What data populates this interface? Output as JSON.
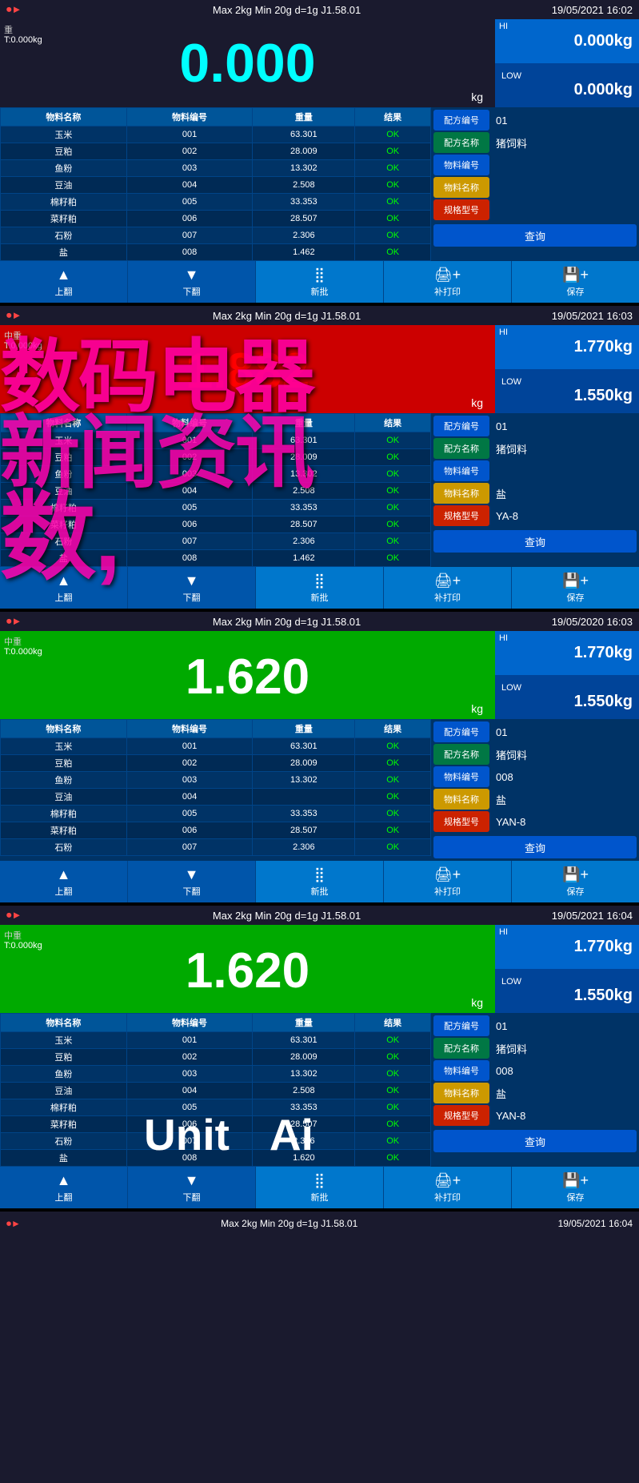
{
  "panels": [
    {
      "id": "panel1",
      "topBar": {
        "left": "⏺►",
        "center": "Max 2kg  Min 20g  d=1g    J1.58.01",
        "right": "19/05/2021  16:02"
      },
      "weight": {
        "zero": "重",
        "tare": "T:0.000kg",
        "value": "0.000",
        "unit": "kg",
        "status": "normal"
      },
      "hi": {
        "label": "HI",
        "value": "0.000",
        "unit": "kg"
      },
      "low": {
        "label": "LOW",
        "value": "0.000",
        "unit": "kg"
      },
      "tableHeaders": [
        "物料名称",
        "物料编号",
        "重量",
        "结果"
      ],
      "tableRows": [
        [
          "玉米",
          "001",
          "63.301",
          "OK"
        ],
        [
          "豆粕",
          "002",
          "28.009",
          "OK"
        ],
        [
          "鱼粉",
          "003",
          "13.302",
          "OK"
        ],
        [
          "豆油",
          "004",
          "2.508",
          "OK"
        ],
        [
          "棉籽粕",
          "005",
          "33.353",
          "OK"
        ],
        [
          "菜籽粕",
          "006",
          "28.507",
          "OK"
        ],
        [
          "石粉",
          "007",
          "2.306",
          "OK"
        ],
        [
          "盐",
          "008",
          "1.462",
          "OK"
        ]
      ],
      "infoPanel": {
        "rows": [
          {
            "label": "配方编号",
            "labelClass": "blue",
            "value": "01"
          },
          {
            "label": "配方名称",
            "labelClass": "green",
            "value": "猪饲料"
          },
          {
            "label": "物料编号",
            "labelClass": "blue",
            "value": ""
          },
          {
            "label": "物料名称",
            "labelClass": "yellow",
            "value": ""
          },
          {
            "label": "规格型号",
            "labelClass": "red",
            "value": ""
          }
        ],
        "queryBtn": "查询"
      },
      "buttons": [
        {
          "icon": "▲",
          "label": "上翻"
        },
        {
          "icon": "▼",
          "label": "下翻"
        },
        {
          "icon": "⣿",
          "label": "新批"
        },
        {
          "icon": "🖨+",
          "label": "补打印"
        },
        {
          "icon": "💾+",
          "label": "保存"
        }
      ]
    },
    {
      "id": "panel2",
      "topBar": {
        "left": "⏺►",
        "center": "Max 2kg  Min 20g  d=1g    J1.58.01",
        "right": "19/05/2021  16:03"
      },
      "weight": {
        "zero": "中重",
        "tare": "T:0.000kg",
        "value": "1.882",
        "unit": "kg",
        "status": "over"
      },
      "hi": {
        "label": "HI",
        "value": "1.770",
        "unit": "kg"
      },
      "low": {
        "label": "LOW",
        "value": "1.550",
        "unit": "kg"
      },
      "tableHeaders": [
        "物料名称",
        "物料编号",
        "重量",
        "结果"
      ],
      "tableRows": [
        [
          "玉米",
          "001",
          "63.301",
          "OK"
        ],
        [
          "豆粕",
          "002",
          "28.009",
          "OK"
        ],
        [
          "鱼粉",
          "003",
          "13.302",
          "OK"
        ],
        [
          "豆油",
          "004",
          "2.508",
          "OK"
        ],
        [
          "棉籽粕",
          "005",
          "33.353",
          "OK"
        ],
        [
          "菜籽粕",
          "006",
          "28.507",
          "OK"
        ],
        [
          "石粉",
          "007",
          "2.306",
          "OK"
        ],
        [
          "盐",
          "008",
          "1.462",
          "OK"
        ]
      ],
      "infoPanel": {
        "rows": [
          {
            "label": "配方编号",
            "labelClass": "blue",
            "value": "01"
          },
          {
            "label": "配方名称",
            "labelClass": "green",
            "value": "猪饲料"
          },
          {
            "label": "物料编号",
            "labelClass": "blue",
            "value": ""
          },
          {
            "label": "物料名称",
            "labelClass": "yellow",
            "value": "盐"
          },
          {
            "label": "规格型号",
            "labelClass": "red",
            "value": "YA-8"
          }
        ],
        "queryBtn": "查询"
      },
      "buttons": [
        {
          "icon": "▲",
          "label": "上翻"
        },
        {
          "icon": "▼",
          "label": "下翻"
        },
        {
          "icon": "⣿",
          "label": "新批"
        },
        {
          "icon": "🖨+",
          "label": "补打印"
        },
        {
          "icon": "💾+",
          "label": "保存"
        }
      ],
      "hasWatermark": true
    },
    {
      "id": "panel3",
      "topBar": {
        "left": "⏺►",
        "center": "Max 2kg  Min 20g  d=1g    J1.58.01",
        "right": "19/05/2020  16:03"
      },
      "weight": {
        "zero": "中重",
        "tare": "T:0.000kg",
        "value": "1.620",
        "unit": "kg",
        "status": "ok"
      },
      "hi": {
        "label": "HI",
        "value": "1.770",
        "unit": "kg"
      },
      "low": {
        "label": "LOW",
        "value": "1.550",
        "unit": "kg"
      },
      "tableHeaders": [
        "物料名称",
        "物料编号",
        "重量",
        "结果"
      ],
      "tableRows": [
        [
          "玉米",
          "001",
          "63.301",
          "OK"
        ],
        [
          "豆粕",
          "002",
          "28.009",
          "OK"
        ],
        [
          "鱼粉",
          "003",
          "13.302",
          "OK"
        ],
        [
          "豆油",
          "004",
          "",
          "OK"
        ],
        [
          "棉籽粕",
          "005",
          "33.353",
          "OK"
        ],
        [
          "菜籽粕",
          "006",
          "28.507",
          "OK"
        ],
        [
          "石粉",
          "007",
          "2.306",
          "OK"
        ]
      ],
      "infoPanel": {
        "rows": [
          {
            "label": "配方编号",
            "labelClass": "blue",
            "value": "01"
          },
          {
            "label": "配方名称",
            "labelClass": "green",
            "value": "猪饲料"
          },
          {
            "label": "物料编号",
            "labelClass": "blue",
            "value": "008"
          },
          {
            "label": "物料名称",
            "labelClass": "yellow",
            "value": "盐"
          },
          {
            "label": "规格型号",
            "labelClass": "red",
            "value": "YAN-8"
          }
        ],
        "queryBtn": "查询"
      },
      "buttons": [
        {
          "icon": "▲",
          "label": "上翻"
        },
        {
          "icon": "▼",
          "label": "下翻"
        },
        {
          "icon": "⣿",
          "label": "新批"
        },
        {
          "icon": "🖨+",
          "label": "补打印"
        },
        {
          "icon": "💾+",
          "label": "保存"
        }
      ],
      "hasWatermark": true
    },
    {
      "id": "panel4",
      "topBar": {
        "left": "⏺►",
        "center": "Max 2kg  Min 20g  d=1g    J1.58.01",
        "right": "19/05/2021  16:04"
      },
      "weight": {
        "zero": "中重",
        "tare": "T:0.000kg",
        "value": "1.620",
        "unit": "kg",
        "status": "ok"
      },
      "hi": {
        "label": "HI",
        "value": "1.770",
        "unit": "kg"
      },
      "low": {
        "label": "LOW",
        "value": "1.550",
        "unit": "kg"
      },
      "tableHeaders": [
        "物料名称",
        "物料编号",
        "重量",
        "结果"
      ],
      "tableRows": [
        [
          "玉米",
          "001",
          "63.301",
          "OK"
        ],
        [
          "豆粕",
          "002",
          "28.009",
          "OK"
        ],
        [
          "鱼粉",
          "003",
          "13.302",
          "OK"
        ],
        [
          "豆油",
          "004",
          "2.508",
          "OK"
        ],
        [
          "棉籽粕",
          "005",
          "33.353",
          "OK"
        ],
        [
          "菜籽粕",
          "006",
          "28.507",
          "OK"
        ],
        [
          "石粉",
          "007",
          "2.306",
          "OK"
        ],
        [
          "盐",
          "008",
          "1.620",
          "OK"
        ]
      ],
      "infoPanel": {
        "rows": [
          {
            "label": "配方编号",
            "labelClass": "blue",
            "value": "01"
          },
          {
            "label": "配方名称",
            "labelClass": "green",
            "value": "猪饲料"
          },
          {
            "label": "物料编号",
            "labelClass": "blue",
            "value": "008"
          },
          {
            "label": "物料名称",
            "labelClass": "yellow",
            "value": "盐"
          },
          {
            "label": "规格型号",
            "labelClass": "red",
            "value": "YAN-8"
          }
        ],
        "queryBtn": "查询"
      },
      "buttons": [
        {
          "icon": "▲",
          "label": "上翻"
        },
        {
          "icon": "▼",
          "label": "下翻"
        },
        {
          "icon": "⣿",
          "label": "新批"
        },
        {
          "icon": "🖨+",
          "label": "补打印"
        },
        {
          "icon": "💾+",
          "label": "保存"
        }
      ],
      "unitAiOverlay": {
        "unit": "Unit",
        "ai": "Ai"
      }
    }
  ],
  "watermarkLines": [
    "数码电器",
    "新闻资讯",
    "数,"
  ],
  "statusBar": {
    "left": "⏺►",
    "center": "Max 2kg  Min 20g  d=1g    J1.58.01",
    "right": "19/05/2021  16:04"
  }
}
